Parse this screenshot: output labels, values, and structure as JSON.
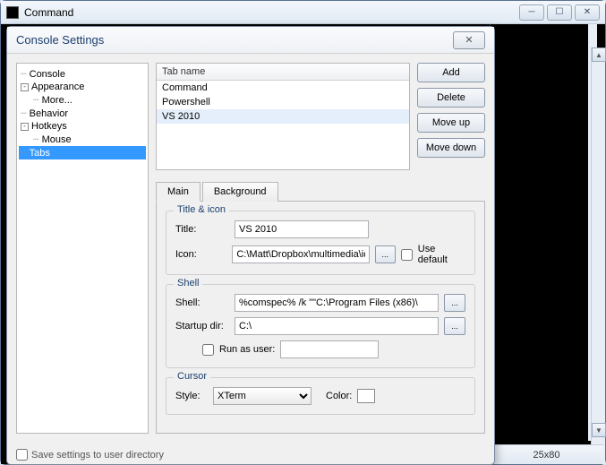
{
  "outer": {
    "title": "Command",
    "status": "25x80"
  },
  "dialog": {
    "title": "Console Settings",
    "footer_label": "Save settings to user directory"
  },
  "tree": [
    {
      "label": "Console",
      "level": 0,
      "toggle": null
    },
    {
      "label": "Appearance",
      "level": 0,
      "toggle": "-"
    },
    {
      "label": "More...",
      "level": 1,
      "toggle": null
    },
    {
      "label": "Behavior",
      "level": 0,
      "toggle": null
    },
    {
      "label": "Hotkeys",
      "level": 0,
      "toggle": "-"
    },
    {
      "label": "Mouse",
      "level": 1,
      "toggle": null
    },
    {
      "label": "Tabs",
      "level": 0,
      "toggle": null,
      "selected": true
    }
  ],
  "tablist": {
    "header": "Tab name",
    "items": [
      {
        "label": "Command"
      },
      {
        "label": "Powershell"
      },
      {
        "label": "VS 2010",
        "selected": true
      }
    ]
  },
  "buttons": {
    "add": "Add",
    "delete": "Delete",
    "moveup": "Move up",
    "movedown": "Move down"
  },
  "tabs": {
    "main": "Main",
    "background": "Background"
  },
  "groups": {
    "title_icon": "Title & icon",
    "shell": "Shell",
    "cursor": "Cursor"
  },
  "fields": {
    "title_label": "Title:",
    "title_value": "VS 2010",
    "icon_label": "Icon:",
    "icon_value": "C:\\Matt\\Dropbox\\multimedia\\icc",
    "use_default": "Use default",
    "shell_label": "Shell:",
    "shell_value": "%comspec% /k \"\"C:\\Program Files (x86)\\",
    "startup_label": "Startup dir:",
    "startup_value": "C:\\",
    "run_as_user": "Run as user:",
    "run_as_user_value": "",
    "style_label": "Style:",
    "style_value": "XTerm",
    "color_label": "Color:",
    "browse": "..."
  }
}
